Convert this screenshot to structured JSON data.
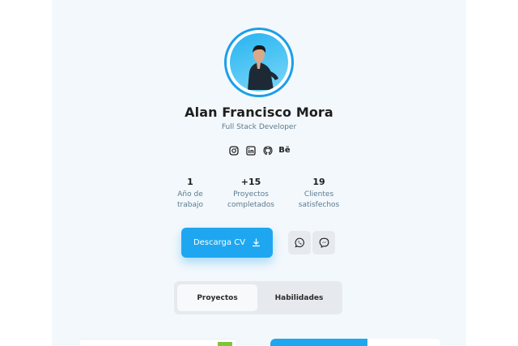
{
  "profile": {
    "name": "Alan Francisco Mora",
    "role": "Full Stack Developer"
  },
  "socials": [
    {
      "icon": "instagram-icon"
    },
    {
      "icon": "linkedin-icon"
    },
    {
      "icon": "github-icon"
    },
    {
      "icon": "behance-icon",
      "glyph": "Bē"
    }
  ],
  "stats": [
    {
      "value": "1",
      "label_line1": "Año de",
      "label_line2": "trabajo"
    },
    {
      "value": "+15",
      "label_line1": "Proyectos",
      "label_line2": "completados"
    },
    {
      "value": "19",
      "label_line1": "Clientes",
      "label_line2": "satisfechos"
    }
  ],
  "actions": {
    "download_cv_label": "Descarga CV",
    "whatsapp_icon": "whatsapp-icon",
    "messenger_icon": "messenger-icon"
  },
  "tabs": [
    {
      "label": "Proyectos",
      "active": true
    },
    {
      "label": "Habilidades",
      "active": false
    }
  ],
  "colors": {
    "accent": "#1ea7f0",
    "panel_bg": "#f3f8fc",
    "muted_text": "#5b7a8e"
  }
}
